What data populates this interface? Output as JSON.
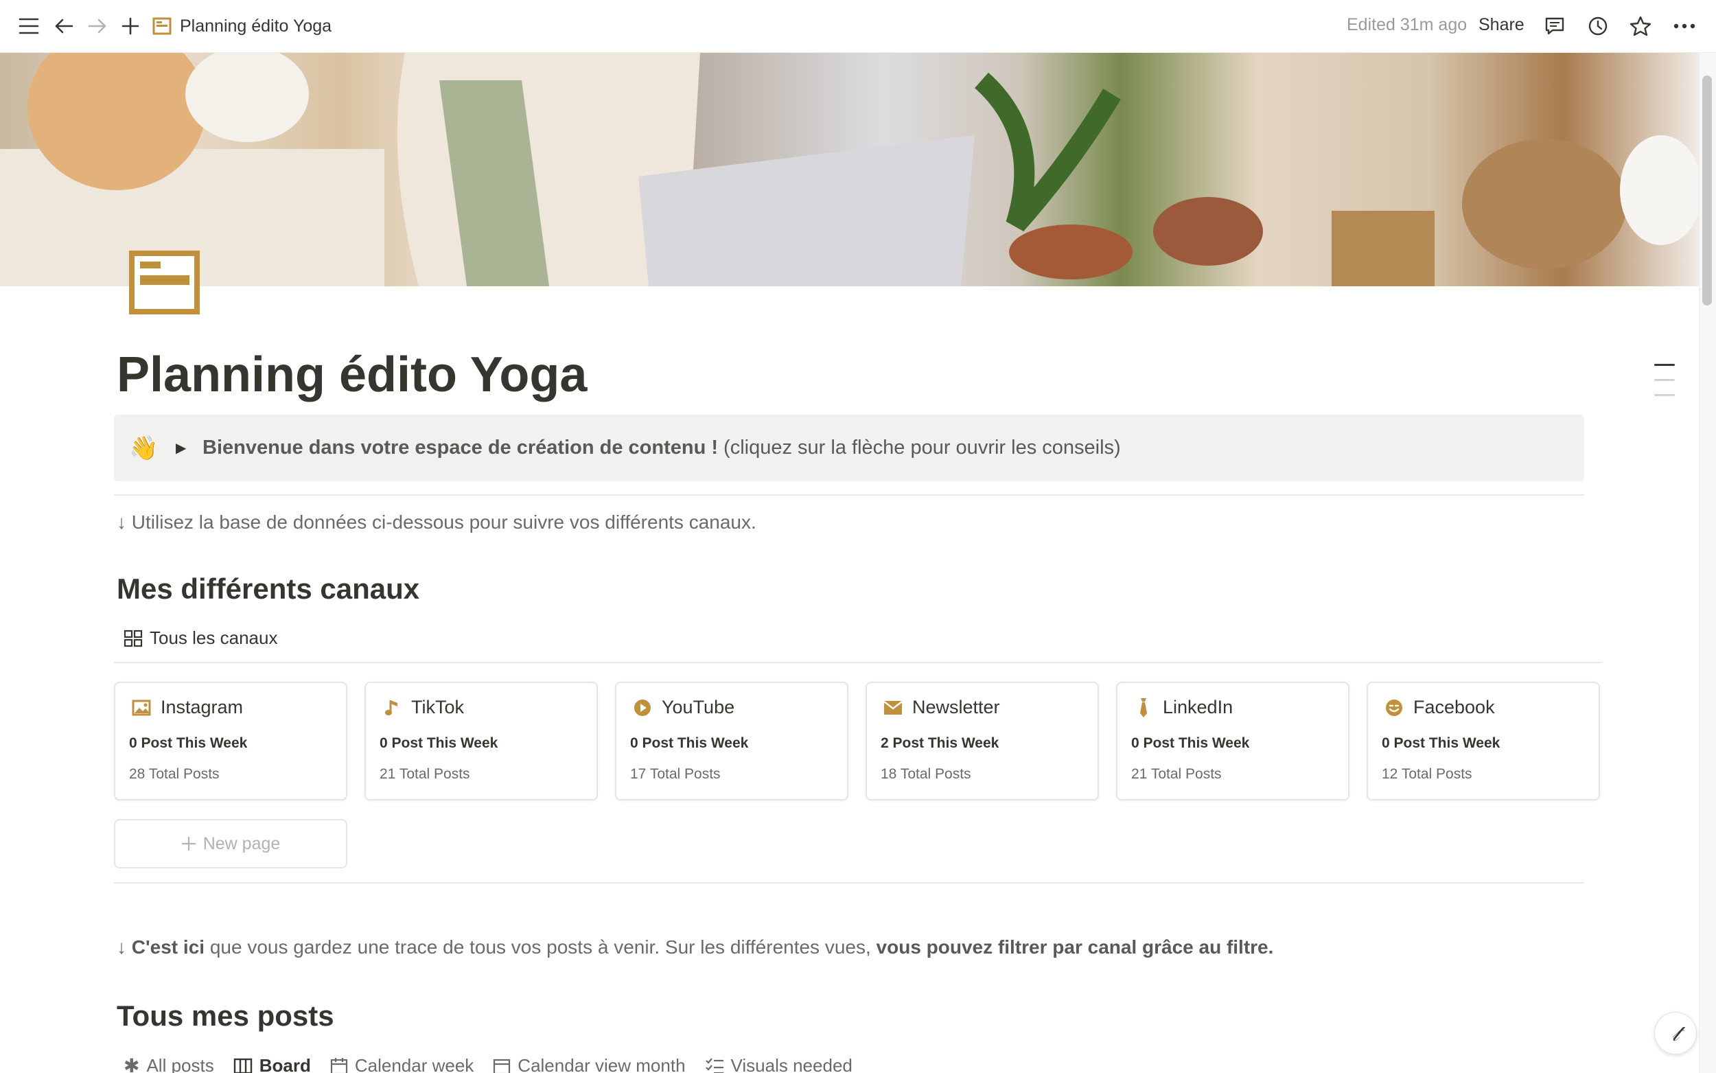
{
  "topbar": {
    "page_title": "Planning édito Yoga",
    "edited": "Edited 31m ago",
    "share": "Share"
  },
  "page": {
    "title": "Planning édito Yoga"
  },
  "callout": {
    "emoji": "👋",
    "bold_text": "Bienvenue dans votre espace de création de contenu !",
    "text": " (cliquez sur la flèche pour ouvrir les conseils)"
  },
  "hint1": "↓ Utilisez la base de données ci-dessous pour suivre vos différents canaux.",
  "section1": {
    "heading": "Mes différents canaux",
    "view_tab": "Tous les canaux"
  },
  "channels": [
    {
      "name": "Instagram",
      "week": "0 Post This Week",
      "total": "28 Total Posts",
      "icon": "image-icon"
    },
    {
      "name": "TikTok",
      "week": "0 Post This Week",
      "total": "21 Total Posts",
      "icon": "music-note-icon"
    },
    {
      "name": "YouTube",
      "week": "0 Post This Week",
      "total": "17 Total Posts",
      "icon": "play-circle-icon"
    },
    {
      "name": "Newsletter",
      "week": "2 Post This Week",
      "total": "18 Total Posts",
      "icon": "envelope-icon"
    },
    {
      "name": "LinkedIn",
      "week": "0 Post This Week",
      "total": "21 Total Posts",
      "icon": "tie-icon"
    },
    {
      "name": "Facebook",
      "week": "0 Post This Week",
      "total": "12 Total Posts",
      "icon": "smile-icon"
    }
  ],
  "new_page": "New page",
  "hint2": {
    "arrow": "↓ ",
    "bold1": "C'est ici",
    "text": " que vous gardez une trace de tous vos posts à venir. Sur les différentes vues, ",
    "bold2": "vous pouvez filtrer par canal grâce au filtre."
  },
  "section2": {
    "heading": "Tous mes posts"
  },
  "views": [
    {
      "label": "All posts",
      "icon": "asterisk-icon"
    },
    {
      "label": "Board",
      "icon": "board-icon"
    },
    {
      "label": "Calendar week",
      "icon": "calendar-icon"
    },
    {
      "label": "Calendar view month",
      "icon": "calendar-icon"
    },
    {
      "label": "Visuals needed",
      "icon": "checklist-icon"
    }
  ],
  "colors": {
    "accent": "#c0913a",
    "text": "#37352f",
    "muted": "#6b6a66"
  }
}
